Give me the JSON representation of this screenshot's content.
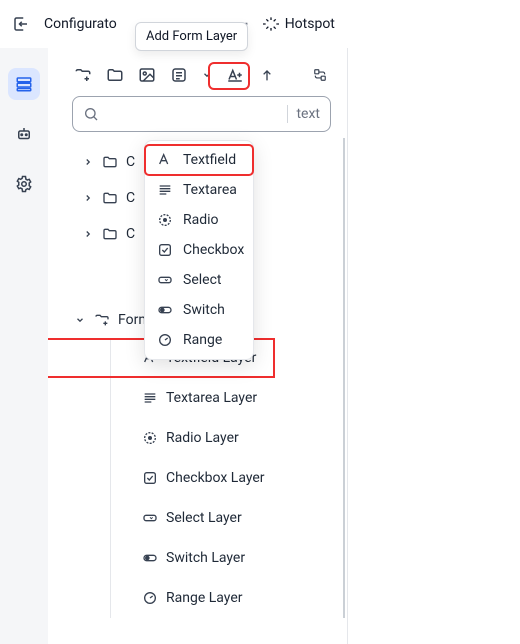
{
  "topbar": {
    "title": "Configurato",
    "tooltip": "Add Form Layer",
    "hotspot_label": "Hotspot"
  },
  "toolbar": {
    "icons": [
      "folder-plus",
      "folder",
      "image",
      "form",
      "text-style",
      "arrow-up",
      "cycle"
    ]
  },
  "search": {
    "placeholder_short": "text"
  },
  "dropdown": {
    "items": [
      {
        "icon": "textfield",
        "label": "Textfield"
      },
      {
        "icon": "textarea",
        "label": "Textarea"
      },
      {
        "icon": "radio",
        "label": "Radio"
      },
      {
        "icon": "checkbox",
        "label": "Checkbox"
      },
      {
        "icon": "select",
        "label": "Select"
      },
      {
        "icon": "switch",
        "label": "Switch"
      },
      {
        "icon": "range",
        "label": "Range"
      }
    ]
  },
  "tree": {
    "collapsed": [
      {
        "label": "C"
      },
      {
        "label": "C"
      },
      {
        "label": "C"
      }
    ],
    "form_group": {
      "label": "Form",
      "children": [
        {
          "icon": "textfield",
          "label": "Textfield Layer"
        },
        {
          "icon": "textarea",
          "label": "Textarea Layer"
        },
        {
          "icon": "radio",
          "label": "Radio Layer"
        },
        {
          "icon": "checkbox",
          "label": "Checkbox Layer"
        },
        {
          "icon": "select",
          "label": "Select Layer"
        },
        {
          "icon": "switch",
          "label": "Switch Layer"
        },
        {
          "icon": "range",
          "label": "Range Layer"
        }
      ]
    }
  }
}
